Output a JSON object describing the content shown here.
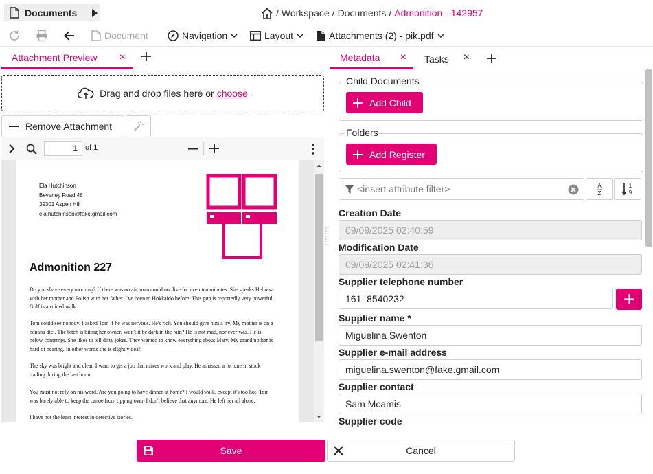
{
  "header": {
    "doc_tab_label": "Documents",
    "breadcrumb": [
      "Workspace",
      "Documents"
    ],
    "breadcrumb_active": "Admonition - 142957"
  },
  "toolbar": {
    "document_label": "Document",
    "navigation_label": "Navigation",
    "layout_label": "Layout",
    "attachments_label": "Attachments (2) - pik.pdf"
  },
  "left_tabs": {
    "preview_label": "Attachment Preview",
    "close_glyph": "×"
  },
  "dropzone": {
    "text": "Drag and drop files here or",
    "link": "choose"
  },
  "remove_attachment_label": "Remove Attachment",
  "viewer": {
    "page_value": "1",
    "page_of": "of 1"
  },
  "pdf": {
    "address": [
      "Ela Hutchinson",
      "Beverley Road 46",
      "39301 Aspen Hill",
      "ela.hutchinson@fake.gmail.com"
    ],
    "title": "Admonition 227",
    "paragraphs": [
      {
        "lines": [
          "Do you shave every morning? If there was no air, man could not live for even ten minutes. She speaks Hebrew",
          "with her mother and Polish with her father. I've been to Hokkaido before. This gun is reportedly very powerful.",
          "Golf is a ruined walk."
        ]
      },
      {
        "lines": [
          "Tom could see nobody. I asked Tom if he was nervous. He's rich. You should give him a try. My mother is on a",
          "banana diet. The bitch is biting her owner. Won't it be dark in the rain? He is not mad, nor ever was. He is",
          "below contempt. She likes to tell dirty jokes. They wanted to know everything about Mary. My grandmother is",
          "hard of hearing. In other words she is slightly deaf."
        ]
      },
      {
        "lines": [
          "The sky was bright and clear. I want to get a job that mixes work and play. He amassed a fortune in stock",
          "trading during the last boom."
        ]
      },
      {
        "lines": [
          "You must not rely on his word. Are you going to have dinner at home? I would walk, except it's too hot. Tom",
          "was barely able to keep the canoe from tipping over. I don't believe that anymore. He left her all alone."
        ]
      },
      {
        "lines": [
          "I have not the least interest in detective stories."
        ]
      }
    ]
  },
  "right_tabs": {
    "metadata_label": "Metadata",
    "tasks_label": "Tasks",
    "close_glyph": "×"
  },
  "metadata": {
    "child_documents_legend": "Child Documents",
    "add_child_label": "Add Child",
    "folders_legend": "Folders",
    "add_register_label": "Add Register",
    "filter_placeholder": "<insert attribute filter>",
    "fields": {
      "creation_date_label": "Creation Date",
      "creation_date_value": "09/09/2025 02:40:59",
      "modification_date_label": "Modification Date",
      "modification_date_value": "09/09/2025 02:41:36",
      "supplier_phone_label": "Supplier telephone number",
      "supplier_phone_value": "161–8540232",
      "supplier_name_label": "Supplier name *",
      "supplier_name_value": "Miguelina Swenton",
      "supplier_email_label": "Supplier e-mail address",
      "supplier_email_value": "miguelina.swenton@fake.gmail.com",
      "supplier_contact_label": "Supplier contact",
      "supplier_contact_value": "Sam Mcamis",
      "supplier_code_label": "Supplier code"
    }
  },
  "footer": {
    "save_label": "Save",
    "cancel_label": "Cancel"
  },
  "colors": {
    "accent": "#e20074"
  },
  "icons": [
    "document-icon",
    "caret-right-icon",
    "home-icon",
    "refresh-icon",
    "print-icon",
    "back-arrow-icon",
    "compass-icon",
    "layout-icon",
    "attachment-icon",
    "chevron-down-icon",
    "close-icon",
    "plus-icon",
    "cloud-upload-icon",
    "minus-icon",
    "magic-wand-icon",
    "sidebar-toggle-icon",
    "search-icon",
    "zoom-out-icon",
    "zoom-in-icon",
    "more-vertical-icon",
    "filter-icon",
    "clear-icon",
    "sort-alpha-icon",
    "sort-numeric-icon",
    "save-icon",
    "logo-icon"
  ]
}
